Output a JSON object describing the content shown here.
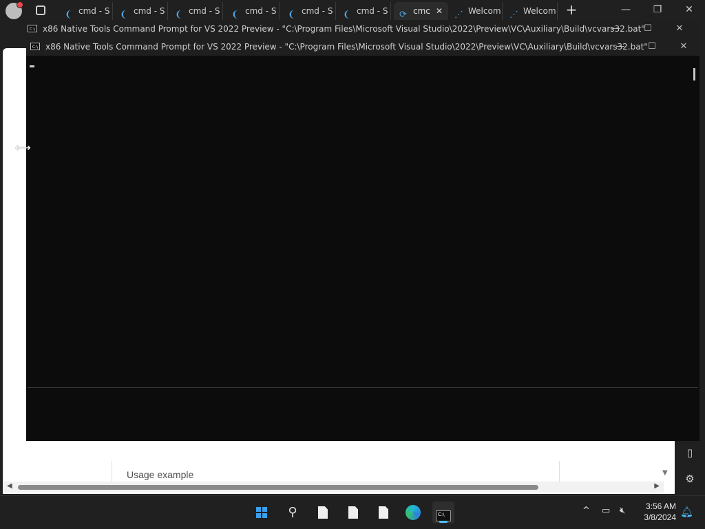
{
  "browser": {
    "tabs": [
      {
        "label": "cmd - S",
        "active": false
      },
      {
        "label": "cmd - S",
        "active": false
      },
      {
        "label": "cmd - S",
        "active": false
      },
      {
        "label": "cmd - S",
        "active": false
      },
      {
        "label": "cmd - S",
        "active": false
      },
      {
        "label": "cmd - S",
        "active": false
      },
      {
        "label": "cmc",
        "active": true
      },
      {
        "label": "Welcom",
        "active": false
      },
      {
        "label": "Welcom",
        "active": false
      }
    ],
    "new_tab_symbol": "+",
    "page": {
      "usage_example": "Usage example"
    }
  },
  "console_windows": [
    {
      "title": "x86 Native Tools Command Prompt for VS 2022 Preview - \"C:\\Program Files\\Microsoft Visual Studio\\2022\\Preview\\VC\\Auxiliary\\Build\\vcvars32.bat\""
    },
    {
      "title": "x86 Native Tools Command Prompt for VS 2022 Preview - \"C:\\Program Files\\Microsoft Visual Studio\\2022\\Preview\\VC\\Auxiliary\\Build\\vcvars32.bat\"",
      "console_text": ""
    }
  ],
  "window_controls": {
    "minimize": "—",
    "maximize": "☐",
    "close": "✕"
  },
  "taskbar": {
    "apps": [
      "start-icon",
      "search-icon",
      "file-icon",
      "file-icon",
      "file-icon",
      "edge-icon",
      "terminal-icon"
    ],
    "tray_chevron": "^",
    "clock": {
      "time": "3:56 AM",
      "date": "3/8/2024"
    }
  },
  "colors": {
    "accent": "#4cc2ff",
    "console_bg": "#0c0c0c",
    "titlebar": "#1f1f1f",
    "taskbar": "#202020"
  }
}
